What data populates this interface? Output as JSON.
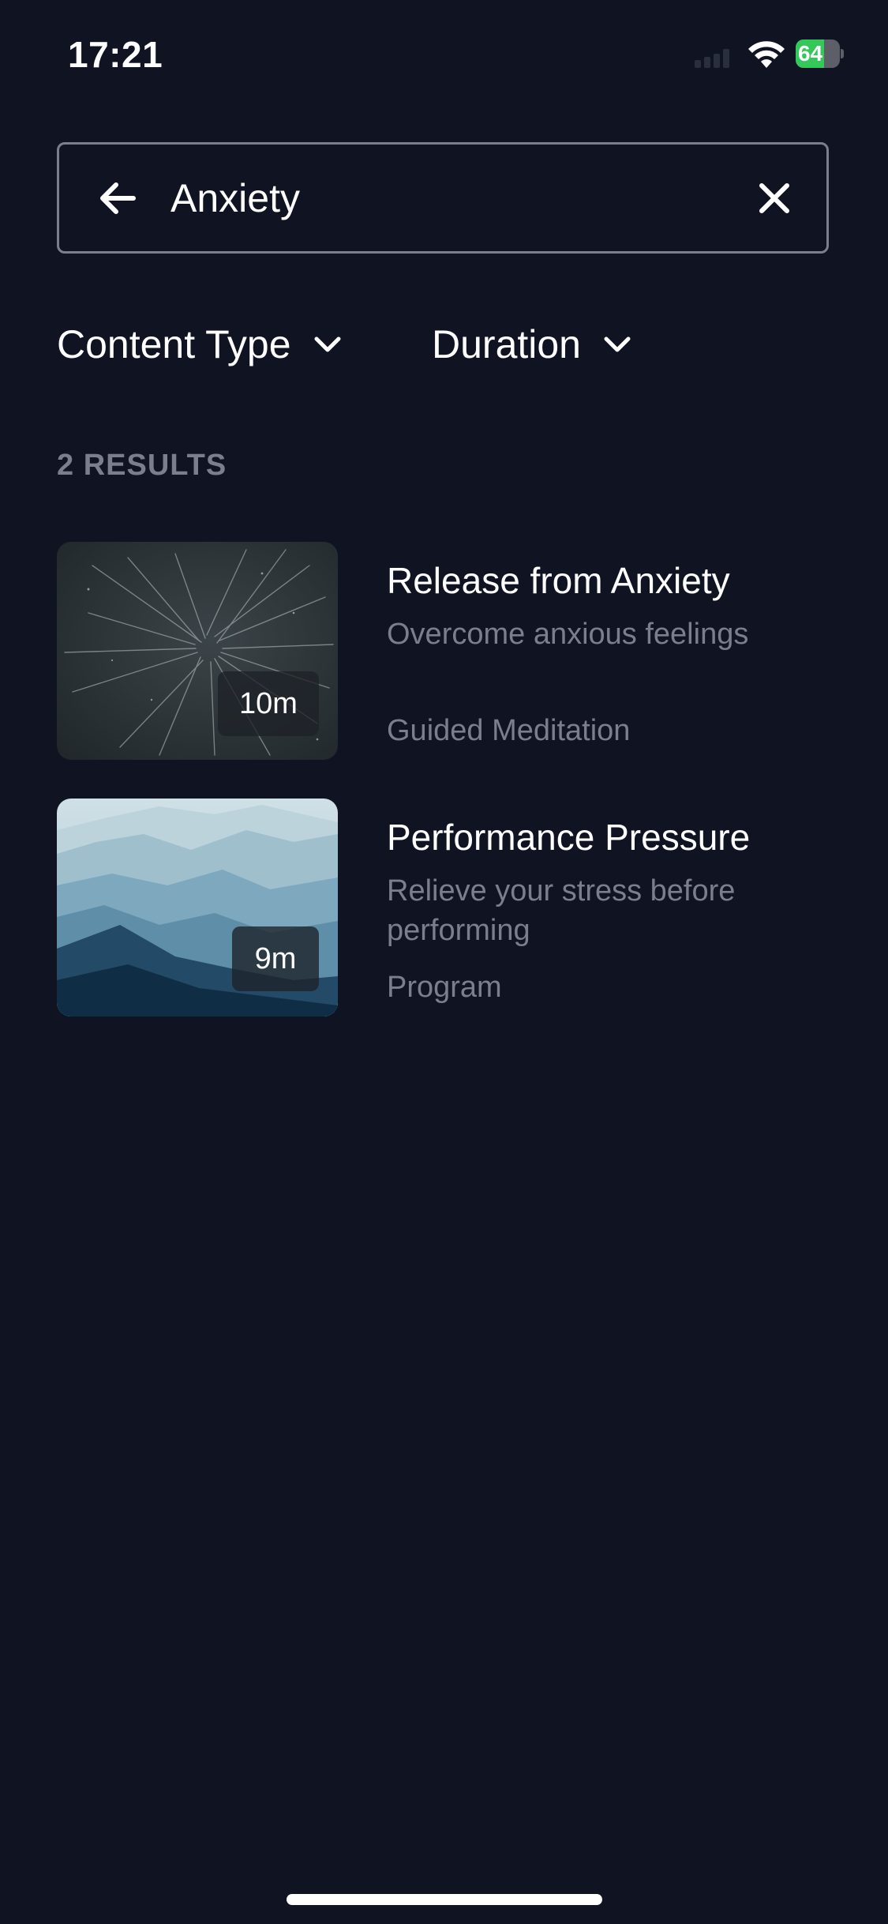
{
  "status_bar": {
    "time": "17:21",
    "battery": "64"
  },
  "search": {
    "query": "Anxiety",
    "placeholder": ""
  },
  "filters": [
    {
      "label": "Content Type"
    },
    {
      "label": "Duration"
    }
  ],
  "results_count": "2 RESULTS",
  "results": [
    {
      "title": "Release from Anxiety",
      "subtitle": "Overcome anxious feelings",
      "type": "Guided Meditation",
      "duration": "10m",
      "thumbnail": "starfield-image"
    },
    {
      "title": "Performance Pressure",
      "subtitle": "Relieve your stress before performing",
      "type": "Program",
      "duration": "9m",
      "thumbnail": "misty-mountains-image"
    }
  ],
  "colors": {
    "background": "#101422",
    "text_primary": "#ffffff",
    "text_secondary": "#7b7f8c",
    "battery_green": "#34c759"
  }
}
